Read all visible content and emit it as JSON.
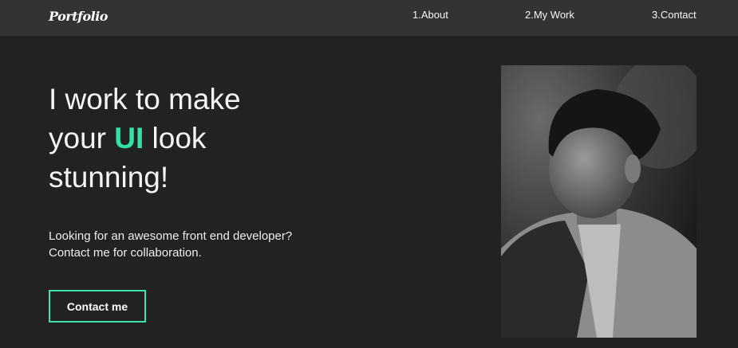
{
  "nav": {
    "logo": "Portfolio",
    "links": [
      "1.About",
      "2.My Work",
      "3.Contact"
    ]
  },
  "hero": {
    "line1": "I work to make",
    "line2_pre": "your ",
    "line2_accent": "UI",
    "line2_post": " look",
    "line3": "stunning!",
    "sub1": "Looking for an awesome front end developer?",
    "sub2": "Contact me for collaboration.",
    "button": "Contact me"
  },
  "colors": {
    "accent": "#35e0a6",
    "background": "#222222",
    "nav": "#333333"
  }
}
